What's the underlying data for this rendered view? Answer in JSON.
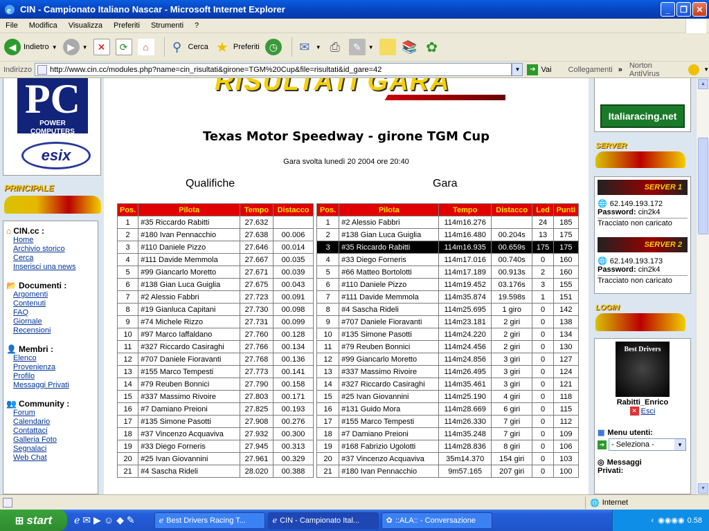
{
  "window": {
    "title": "CIN - Campionato Italiano Nascar - Microsoft Internet Explorer"
  },
  "menu": [
    "File",
    "Modifica",
    "Visualizza",
    "Preferiti",
    "Strumenti",
    "?"
  ],
  "toolbar": {
    "back": "Indietro",
    "search": "Cerca",
    "favorites": "Preferiti"
  },
  "address": {
    "label": "Indirizzo",
    "url": "http://www.cin.cc/modules.php?name=cin_risultati&girone=TGM%20Cup&file=risultati&id_gare=42",
    "go": "Vai",
    "links": "Collegamenti",
    "norton": "Norton AntiVirus"
  },
  "left": {
    "pc": "PC",
    "pc_sub": "POWER COMPUTERS",
    "esix": "esix",
    "principale": "PRINCIPALE",
    "sections": [
      {
        "title": "CIN.cc :",
        "links": [
          "Home",
          "Archivio storico",
          "Cerca",
          "Inserisci una news"
        ]
      },
      {
        "title": "Documenti :",
        "links": [
          "Argomenti",
          "Contenuti",
          "FAQ",
          "Giornale",
          "Recensioni"
        ]
      },
      {
        "title": "Membri :",
        "links": [
          "Elenco",
          "Provenienza",
          "Profilo",
          "Messaggi Privati"
        ]
      },
      {
        "title": "Community :",
        "links": [
          "Forum",
          "Calendario",
          "Contattaci",
          "Galleria Foto",
          "Segnalaci",
          "Web Chat"
        ]
      }
    ]
  },
  "main": {
    "banner": "RISULTATI GARA",
    "title": "Texas Motor Speedway - girone TGM Cup",
    "subtitle": "Gara svolta lunedì 20 2004 ore 20:40",
    "qual_heading": "Qualifiche",
    "race_heading": "Gara"
  },
  "qual": {
    "headers": [
      "Pos.",
      "Pilota",
      "Tempo",
      "Distacco"
    ],
    "rows": [
      [
        "1",
        "#35 Riccardo Rabitti",
        "27.632",
        ""
      ],
      [
        "2",
        "#180 Ivan Pennacchio",
        "27.638",
        "00.006"
      ],
      [
        "3",
        "#110 Daniele Pizzo",
        "27.646",
        "00.014"
      ],
      [
        "4",
        "#111 Davide Memmola",
        "27.667",
        "00.035"
      ],
      [
        "5",
        "#99 Giancarlo Moretto",
        "27.671",
        "00.039"
      ],
      [
        "6",
        "#138 Gian Luca Guiglia",
        "27.675",
        "00.043"
      ],
      [
        "7",
        "#2 Alessio Fabbri",
        "27.723",
        "00.091"
      ],
      [
        "8",
        "#19 Gianluca Capitani",
        "27.730",
        "00.098"
      ],
      [
        "9",
        "#74 Michele Rizzo",
        "27.731",
        "00.099"
      ],
      [
        "10",
        "#97 Marco Iaffaldano",
        "27.760",
        "00.128"
      ],
      [
        "11",
        "#327 Riccardo Casiraghi",
        "27.766",
        "00.134"
      ],
      [
        "12",
        "#707 Daniele Fioravanti",
        "27.768",
        "00.136"
      ],
      [
        "13",
        "#155 Marco Tempesti",
        "27.773",
        "00.141"
      ],
      [
        "14",
        "#79 Reuben Bonnici",
        "27.790",
        "00.158"
      ],
      [
        "15",
        "#337 Massimo Rivoire",
        "27.803",
        "00.171"
      ],
      [
        "16",
        "#7 Damiano Preioni",
        "27.825",
        "00.193"
      ],
      [
        "17",
        "#135 Simone Pasotti",
        "27.908",
        "00.276"
      ],
      [
        "18",
        "#37 Vincenzo Acquaviva",
        "27.932",
        "00.300"
      ],
      [
        "19",
        "#33 Diego Forneris",
        "27.945",
        "00.313"
      ],
      [
        "20",
        "#25 Ivan Giovannini",
        "27.961",
        "00.329"
      ],
      [
        "21",
        "#4 Sascha Rideli",
        "28.020",
        "00.388"
      ]
    ]
  },
  "race": {
    "headers": [
      "Pos.",
      "Pilota",
      "Tempo",
      "Distacco",
      "Led",
      "Punti"
    ],
    "rows": [
      [
        "1",
        "#2 Alessio Fabbri",
        "114m16.276",
        "",
        "24",
        "185"
      ],
      [
        "2",
        "#138 Gian Luca Guiglia",
        "114m16.480",
        "00.204s",
        "13",
        "175"
      ],
      [
        "3",
        "#35 Riccardo Rabitti",
        "114m16.935",
        "00.659s",
        "175",
        "175"
      ],
      [
        "4",
        "#33 Diego Forneris",
        "114m17.016",
        "00.740s",
        "0",
        "160"
      ],
      [
        "5",
        "#66 Matteo Bortolotti",
        "114m17.189",
        "00.913s",
        "2",
        "160"
      ],
      [
        "6",
        "#110 Daniele Pizzo",
        "114m19.452",
        "03.176s",
        "3",
        "155"
      ],
      [
        "7",
        "#111 Davide Memmola",
        "114m35.874",
        "19.598s",
        "1",
        "151"
      ],
      [
        "8",
        "#4 Sascha Rideli",
        "114m25.695",
        "1 giro",
        "0",
        "142"
      ],
      [
        "9",
        "#707 Daniele Fioravanti",
        "114m23.181",
        "2 giri",
        "0",
        "138"
      ],
      [
        "10",
        "#135 Simone Pasotti",
        "114m24.220",
        "2 giri",
        "0",
        "134"
      ],
      [
        "11",
        "#79 Reuben Bonnici",
        "114m24.456",
        "2 giri",
        "0",
        "130"
      ],
      [
        "12",
        "#99 Giancarlo Moretto",
        "114m24.856",
        "3 giri",
        "0",
        "127"
      ],
      [
        "13",
        "#337 Massimo Rivoire",
        "114m26.495",
        "3 giri",
        "0",
        "124"
      ],
      [
        "14",
        "#327 Riccardo Casiraghi",
        "114m35.461",
        "3 giri",
        "0",
        "121"
      ],
      [
        "15",
        "#25 Ivan Giovannini",
        "114m25.190",
        "4 giri",
        "0",
        "118"
      ],
      [
        "16",
        "#131 Guido Mora",
        "114m28.669",
        "6 giri",
        "0",
        "115"
      ],
      [
        "17",
        "#155 Marco Tempesti",
        "114m26.330",
        "7 giri",
        "0",
        "112"
      ],
      [
        "18",
        "#7 Damiano Preioni",
        "114m35.248",
        "7 giri",
        "0",
        "109"
      ],
      [
        "19",
        "#168 Fabrizio Ugolotti",
        "114m28.836",
        "8 giri",
        "0",
        "106"
      ],
      [
        "20",
        "#37 Vincenzo Acquaviva",
        "35m14.370",
        "154 giri",
        "0",
        "103"
      ],
      [
        "21",
        "#180 Ivan Pennacchio",
        "9m57.165",
        "207 giri",
        "0",
        "100"
      ]
    ]
  },
  "right": {
    "italiaracing": "Italiaracing.net",
    "server_label": "SERVER",
    "server1": {
      "title": "SERVER 1",
      "ip": "62.149.193.172",
      "pw_label": "Password:",
      "pw": "cin2k4",
      "note": "Tracciato non caricato"
    },
    "server2": {
      "title": "SERVER 2",
      "ip": "62.149.193.173",
      "pw_label": "Password:",
      "pw": "cin2k4",
      "note": "Tracciato non caricato"
    },
    "login_label": "LOGIN",
    "best": "Best Drivers",
    "user": "Rabitti_Enrico",
    "exit": "Esci",
    "menu_utenti": "Menu utenti:",
    "select": "- Seleziona -",
    "messaggi": "Messaggi",
    "privati": "Privati:"
  },
  "status": {
    "zone": "Internet"
  },
  "taskbar": {
    "start": "start",
    "tasks": [
      "Best Drivers Racing T...",
      "CIN - Campionato Ital...",
      "::ALA:: - Conversazione"
    ],
    "clock": "0.58"
  }
}
